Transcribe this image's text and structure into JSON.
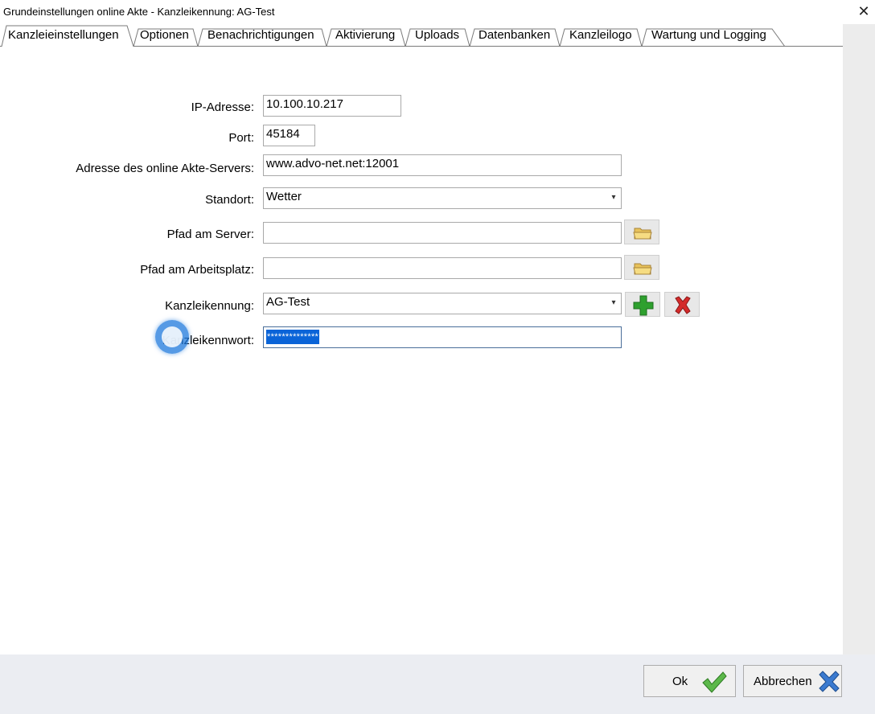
{
  "window": {
    "title": "Grundeinstellungen online Akte - Kanzleikennung: AG-Test",
    "close_glyph": "✕"
  },
  "tabs": [
    {
      "label": "Kanzleieinstellungen",
      "active": true
    },
    {
      "label": "Optionen"
    },
    {
      "label": "Benachrichtigungen"
    },
    {
      "label": "Aktivierung"
    },
    {
      "label": "Uploads"
    },
    {
      "label": "Datenbanken"
    },
    {
      "label": "Kanzleilogo"
    },
    {
      "label": "Wartung und Logging"
    }
  ],
  "form": {
    "ip": {
      "label": "IP-Adresse:",
      "value": "10.100.10.217"
    },
    "port": {
      "label": "Port:",
      "value": "45184"
    },
    "server_address": {
      "label": "Adresse des online Akte-Servers:",
      "value": "www.advo-net.net:12001"
    },
    "location": {
      "label": "Standort:",
      "value": "Wetter"
    },
    "server_path": {
      "label": "Pfad am Server:",
      "value": ""
    },
    "workstation_path": {
      "label": "Pfad am Arbeitsplatz:",
      "value": ""
    },
    "firm_id": {
      "label": "Kanzleikennung:",
      "value": "AG-Test"
    },
    "firm_password": {
      "label": "Kanzleikennwort:",
      "value": "**************"
    }
  },
  "buttons": {
    "ok_label": "Ok",
    "cancel_label": "Abbrechen"
  },
  "icons": {
    "folder": "folder-icon",
    "add": "plus-icon",
    "delete": "delete-x-icon",
    "ok": "checkmark-icon",
    "cancel": "cancel-x-icon"
  },
  "colors": {
    "selection": "#0a64d8",
    "add_green": "#2ea02e",
    "delete_red": "#d42a2a",
    "cancel_blue": "#3a7ad0"
  }
}
